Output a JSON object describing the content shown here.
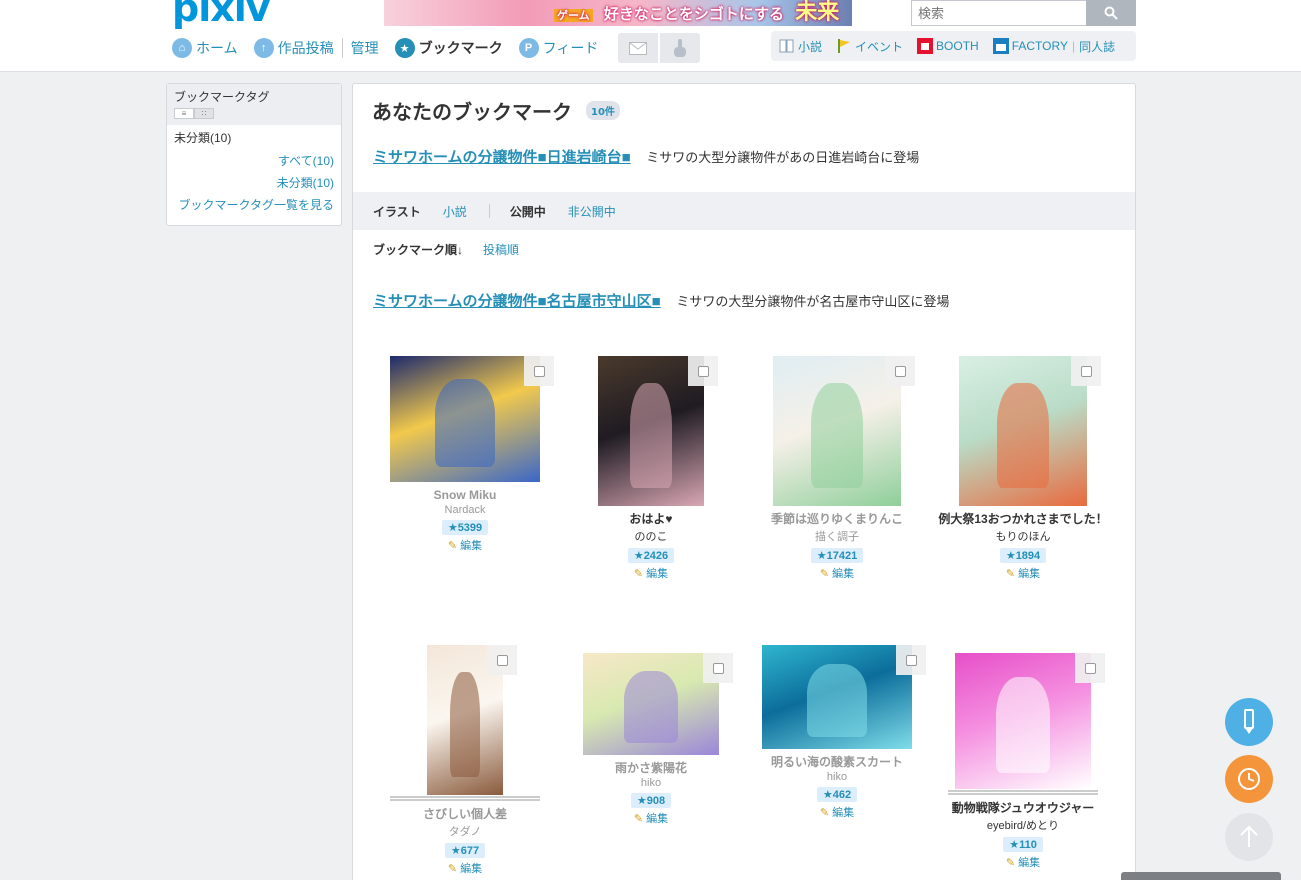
{
  "header": {
    "logo": "pixiv",
    "banner_text": "好きなことをシゴトにする",
    "banner_big": "未来",
    "banner_tag": "ゲーム",
    "search_placeholder": "検索"
  },
  "global_nav": [
    {
      "label": "ホーム",
      "icon": "home-icon",
      "current": false
    },
    {
      "label": "作品投稿",
      "icon": "upload-icon",
      "current": false
    },
    {
      "label": "管理",
      "icon": "",
      "current": false
    },
    {
      "label": "ブックマーク",
      "icon": "star-icon",
      "current": true
    },
    {
      "label": "フィード",
      "icon": "feed-icon",
      "current": false
    }
  ],
  "service_nav": [
    {
      "label": "小説",
      "icon": "novel-icon"
    },
    {
      "label": "イベント",
      "icon": "flag-icon"
    },
    {
      "label": "BOOTH",
      "icon": "booth-icon"
    },
    {
      "label": "FACTORY",
      "icon": "factory-icon"
    },
    {
      "label": "同人誌",
      "icon": ""
    }
  ],
  "sidebar": {
    "title": "ブックマークタグ",
    "uncategorized": "未分類(10)",
    "links": [
      "すべて(10)",
      "未分類(10)",
      "ブックマークタグ一覧を見る"
    ]
  },
  "main": {
    "title": "あなたのブックマーク",
    "count": "10件",
    "ad_top": {
      "link": "ミサワホームの分譲物件■日進岩崎台■",
      "text": "ミサワの大型分譲物件があの日進岩崎台に登場"
    },
    "ad_mid": {
      "link": "ミサワホームの分譲物件■名古屋市守山区■",
      "text": "ミサワの大型分譲物件が名古屋市守山区に登場"
    },
    "filters": {
      "type_current": "イラスト",
      "type_other": "小説",
      "pub_current": "公開中",
      "pub_other": "非公開中"
    },
    "sort": {
      "current": "ブックマーク順↓",
      "other": "投稿順"
    },
    "edit_label": "編集",
    "items": [
      {
        "title": "Snow Miku",
        "user": "Nardack",
        "bookmarks": "5399",
        "dim": true,
        "colors": [
          "#1d2a6e",
          "#3a67c8",
          "#f2c94c"
        ]
      },
      {
        "title": "おはよ♥",
        "user": "ののこ",
        "bookmarks": "2426",
        "dim": false,
        "colors": [
          "#4a3a2c",
          "#d9a7b4",
          "#1f1b22"
        ]
      },
      {
        "title": "季節は巡りゆくまりんこ",
        "user": "描く調子",
        "bookmarks": "17421",
        "dim": true,
        "colors": [
          "#dfeef3",
          "#8fcf9a",
          "#f5f0e8"
        ]
      },
      {
        "title": "例大祭13おつかれさまでした！",
        "user": "もりのほん",
        "bookmarks": "1894",
        "dim": false,
        "colors": [
          "#d9efe4",
          "#e96a3e",
          "#b9dcc7"
        ]
      },
      {
        "title": "さびしい個人差",
        "user": "タダノ",
        "bookmarks": "677",
        "dim": true,
        "colors": [
          "#f3e6d8",
          "#8a5a3c",
          "#fbf6ef"
        ]
      },
      {
        "title": "雨かさ紫陽花",
        "user": "hiko",
        "bookmarks": "908",
        "dim": true,
        "colors": [
          "#f7e8c8",
          "#9a86d9",
          "#d8e9b0"
        ]
      },
      {
        "title": "明るい海の酸素スカート",
        "user": "hiko",
        "bookmarks": "462",
        "dim": true,
        "colors": [
          "#2fb6cf",
          "#7fdde8",
          "#0c6d9b"
        ]
      },
      {
        "title": "動物戦隊ジュウオウジャー",
        "user": "eyebird/めとり",
        "bookmarks": "110",
        "dim": false,
        "colors": [
          "#e64fc8",
          "#ffffff",
          "#f58fe0"
        ]
      }
    ]
  }
}
